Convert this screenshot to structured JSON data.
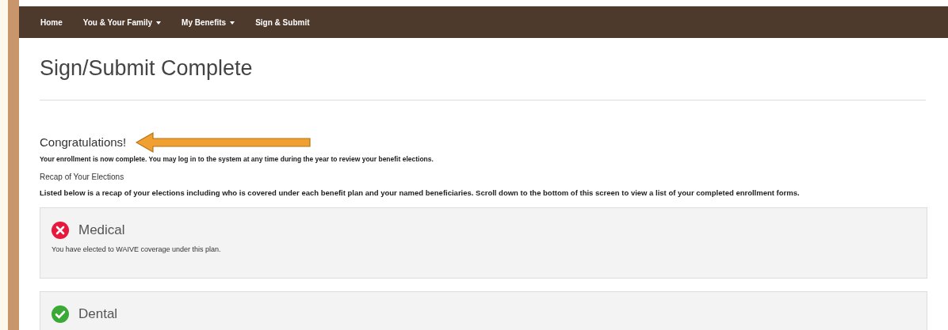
{
  "nav": [
    {
      "label": "Home",
      "dropdown": false
    },
    {
      "label": "You & Your Family",
      "dropdown": true
    },
    {
      "label": "My Benefits",
      "dropdown": true
    },
    {
      "label": "Sign & Submit",
      "dropdown": false
    }
  ],
  "page_title": "Sign/Submit Complete",
  "heading": "Congratulations!",
  "message": "Your enrollment is now complete. You may log in to the system at any time during the year to review your benefit elections.",
  "recap_title": "Recap of Your Elections",
  "recap_text": "Listed below is a recap of your elections including who is covered under each benefit plan and your named beneficiaries. Scroll down to the bottom of this screen to view a list of your completed enrollment forms.",
  "plans": [
    {
      "name": "Medical",
      "kind": "waived",
      "note": "You have elected to WAIVE coverage under this plan."
    },
    {
      "name": "Dental",
      "kind": "elected"
    }
  ]
}
